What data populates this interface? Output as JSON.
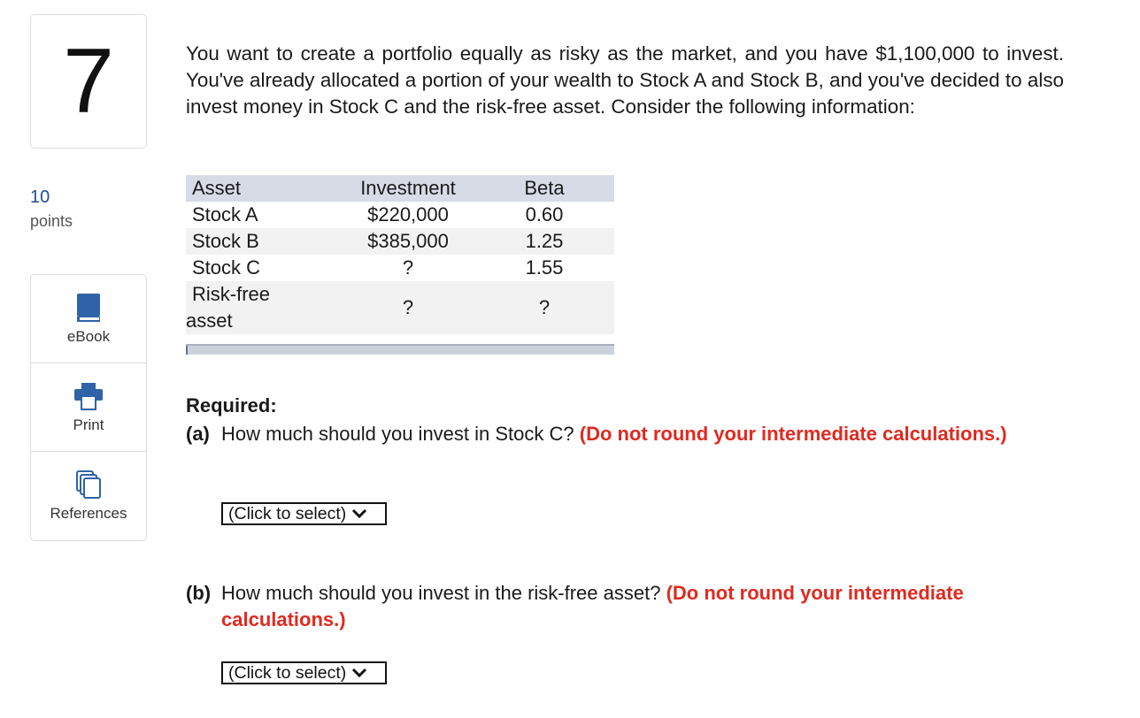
{
  "question": {
    "number": "7",
    "points_value": "10",
    "points_label": "points"
  },
  "tools": [
    {
      "label": "eBook",
      "icon": "book-icon"
    },
    {
      "label": "Print",
      "icon": "printer-icon"
    },
    {
      "label": "References",
      "icon": "references-icon"
    }
  ],
  "intro": "You want to create a portfolio equally as risky as the market, and you have $1,100,000 to invest. You've already allocated a portion of your wealth to Stock A and Stock B, and you've decided to also invest money in Stock C and the risk-free asset. Consider the following information:",
  "table": {
    "headers": [
      "Asset",
      "Investment",
      "Beta"
    ],
    "rows": [
      {
        "asset": "Stock A",
        "investment": "$220,000",
        "beta": "0.60"
      },
      {
        "asset": "Stock B",
        "investment": "$385,000",
        "beta": "1.25"
      },
      {
        "asset": "Stock C",
        "investment": "?",
        "beta": "1.55"
      },
      {
        "asset_line1": "Risk-free",
        "asset_line2": "asset",
        "investment": "?",
        "beta": "?"
      }
    ]
  },
  "required_label": "Required:",
  "part_a": {
    "tag": "(a)",
    "text": "How much should you invest in Stock C?",
    "warning": "(Do not round your intermediate calculations.)",
    "select_value": "(Click to select)"
  },
  "part_b": {
    "tag": "(b)",
    "text": "How much should you invest in the risk-free asset?",
    "warning": "(Do not round your intermediate calculations.)",
    "select_value": "(Click to select)"
  },
  "colors": {
    "accent_blue": "#2f63a8",
    "warning_red": "#e02a1f",
    "table_header": "#d6dbe6",
    "row_shade": "#f2f2f2"
  }
}
